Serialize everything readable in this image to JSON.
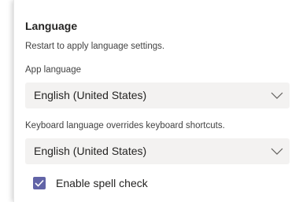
{
  "section": {
    "title": "Language",
    "note": "Restart to apply language settings."
  },
  "app_language": {
    "label": "App language",
    "value": "English (United States)"
  },
  "keyboard_language": {
    "label": "Keyboard language overrides keyboard shortcuts.",
    "value": "English (United States)"
  },
  "spell_check": {
    "label": "Enable spell check",
    "checked": true
  },
  "colors": {
    "accent": "#6264a7",
    "select_bg": "#f3f2f1"
  },
  "icons": {
    "dropdown": "chevron-down-icon",
    "checkbox": "checkmark-icon"
  }
}
